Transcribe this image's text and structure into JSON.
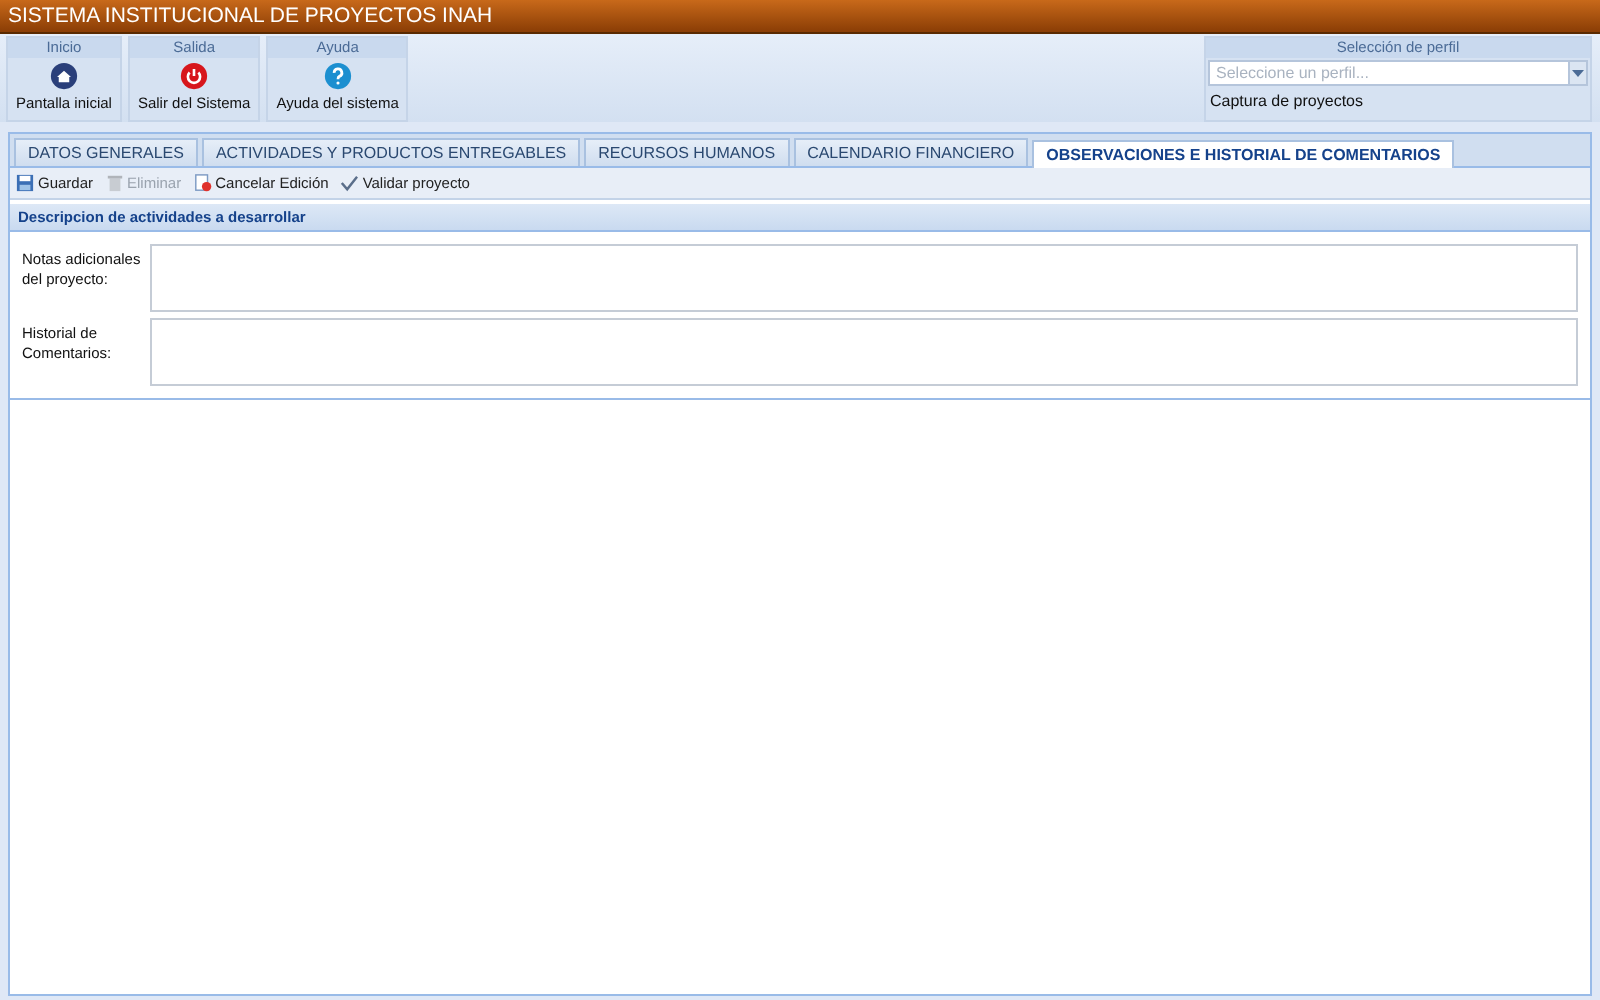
{
  "window": {
    "title": "SISTEMA INSTITUCIONAL DE PROYECTOS INAH"
  },
  "ribbon": [
    {
      "group": "Inicio",
      "label": "Pantalla inicial",
      "kind": "home"
    },
    {
      "group": "Salida",
      "label": "Salir del Sistema",
      "kind": "exit"
    },
    {
      "group": "Ayuda",
      "label": "Ayuda del sistema",
      "kind": "help"
    }
  ],
  "profile": {
    "title": "Selección de perfil",
    "placeholder": "Seleccione un perfil...",
    "current": "Captura de proyectos"
  },
  "tabs": [
    {
      "label": "DATOS GENERALES",
      "selected": false
    },
    {
      "label": "ACTIVIDADES Y PRODUCTOS ENTREGABLES",
      "selected": false
    },
    {
      "label": "RECURSOS HUMANOS",
      "selected": false
    },
    {
      "label": "CALENDARIO FINANCIERO",
      "selected": false
    },
    {
      "label": "OBSERVACIONES E HISTORIAL DE COMENTARIOS",
      "selected": true
    }
  ],
  "toolbar": [
    {
      "label": "Guardar",
      "kind": "save",
      "disabled": false
    },
    {
      "label": "Eliminar",
      "kind": "delete",
      "disabled": true
    },
    {
      "label": "Cancelar Edición",
      "kind": "cancel",
      "disabled": false
    },
    {
      "label": "Validar proyecto",
      "kind": "validate",
      "disabled": false
    }
  ],
  "section": {
    "title": "Descripcion de actividades a desarrollar"
  },
  "fields": [
    {
      "label": "Notas adicionales del proyecto:"
    },
    {
      "label": "Historial de Comentarios:"
    }
  ]
}
